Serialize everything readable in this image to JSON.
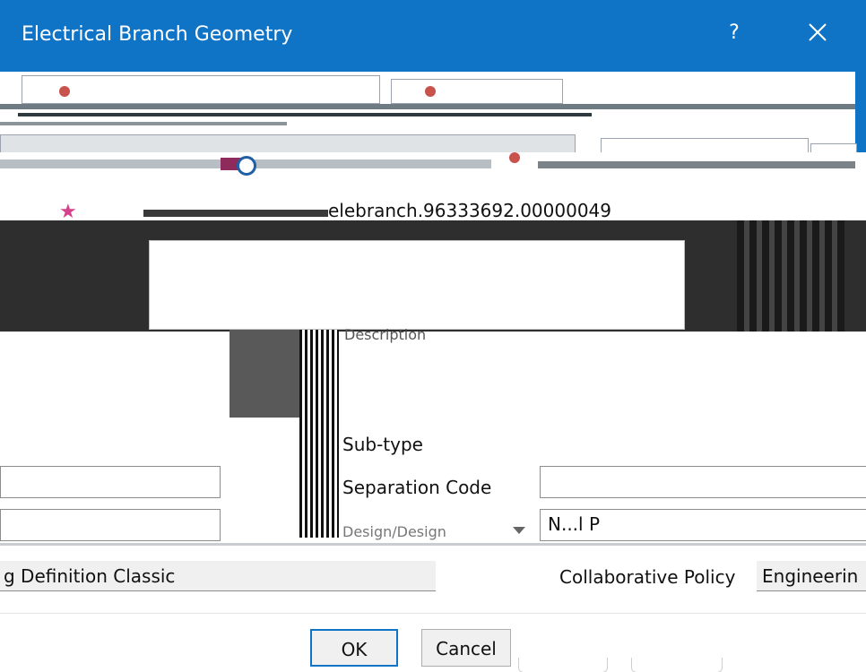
{
  "window": {
    "title": "Electrical Branch Geometry",
    "help_label": "?",
    "accent": "#0f73c6"
  },
  "general": {
    "name_value": "elebranch.96333692.00000049",
    "description_label": "Description"
  },
  "fields": {
    "subtype_label": "Sub-type",
    "separation_code_label": "Separation Code",
    "design_label": "Design/Design",
    "design_value": "N...l P"
  },
  "bottom": {
    "definition_value": "g Definition Classic",
    "collaborative_policy_label": "Collaborative Policy",
    "collaborative_policy_value": "Engineerin"
  },
  "buttons": {
    "ok_label": "OK",
    "cancel_label": "Cancel"
  },
  "icons": [
    "close-icon",
    "help-icon",
    "star-icon",
    "dropdown-arrow-icon"
  ]
}
